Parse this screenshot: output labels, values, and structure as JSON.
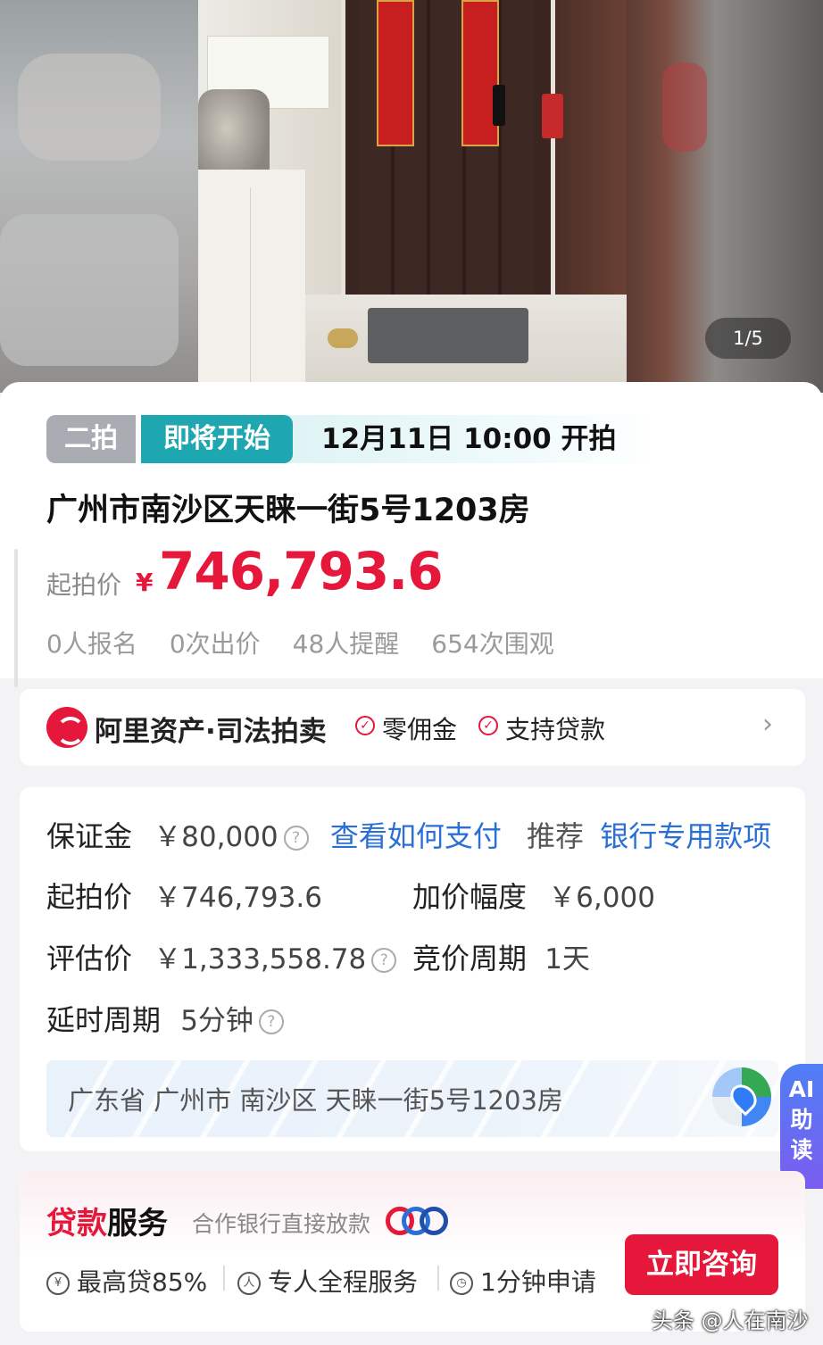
{
  "gallery": {
    "counter": "1/5"
  },
  "auction": {
    "round_tag": "二拍",
    "status_tag": "即将开始",
    "start_time": "12月11日 10:00 开拍",
    "title": "广州市南沙区天睐一街5号1203房",
    "price_label": "起拍价",
    "currency": "¥",
    "price": "746,793.6",
    "stats": [
      "0人报名",
      "0次出价",
      "48人提醒",
      "654次围观"
    ]
  },
  "platform": {
    "name": "阿里资产·司法拍卖",
    "perks": [
      "零佣金",
      "支持贷款"
    ],
    "chevron": "›"
  },
  "details": {
    "deposit_label": "保证金",
    "deposit_value": "￥80,000",
    "how_to_pay": "查看如何支付",
    "recommend_label": "推荐",
    "bank_account": "银行专用款项",
    "start_price_label": "起拍价",
    "start_price_value": "￥746,793.6",
    "increment_label": "加价幅度",
    "increment_value": "￥6,000",
    "appraisal_label": "评估价",
    "appraisal_value": "￥1,333,558.78",
    "cycle_label": "竞价周期",
    "cycle_value": "1天",
    "delay_label": "延时周期",
    "delay_value": "5分钟",
    "address": "广东省 广州市 南沙区 天睐一街5号1203房"
  },
  "ai_tab": {
    "line1": "AI",
    "line2": "助",
    "line3": "读"
  },
  "loan": {
    "title_highlight": "贷款",
    "title_rest": "服务",
    "subtitle": "合作银行直接放款",
    "features": [
      "最高贷85%",
      "专人全程服务",
      "1分钟申请"
    ],
    "consult_button": "立即咨询"
  },
  "watermark": "头条 @人在南沙",
  "colors": {
    "accent_red": "#e5173a",
    "status_teal": "#1ea7b0",
    "link_blue": "#2a6fd6"
  }
}
